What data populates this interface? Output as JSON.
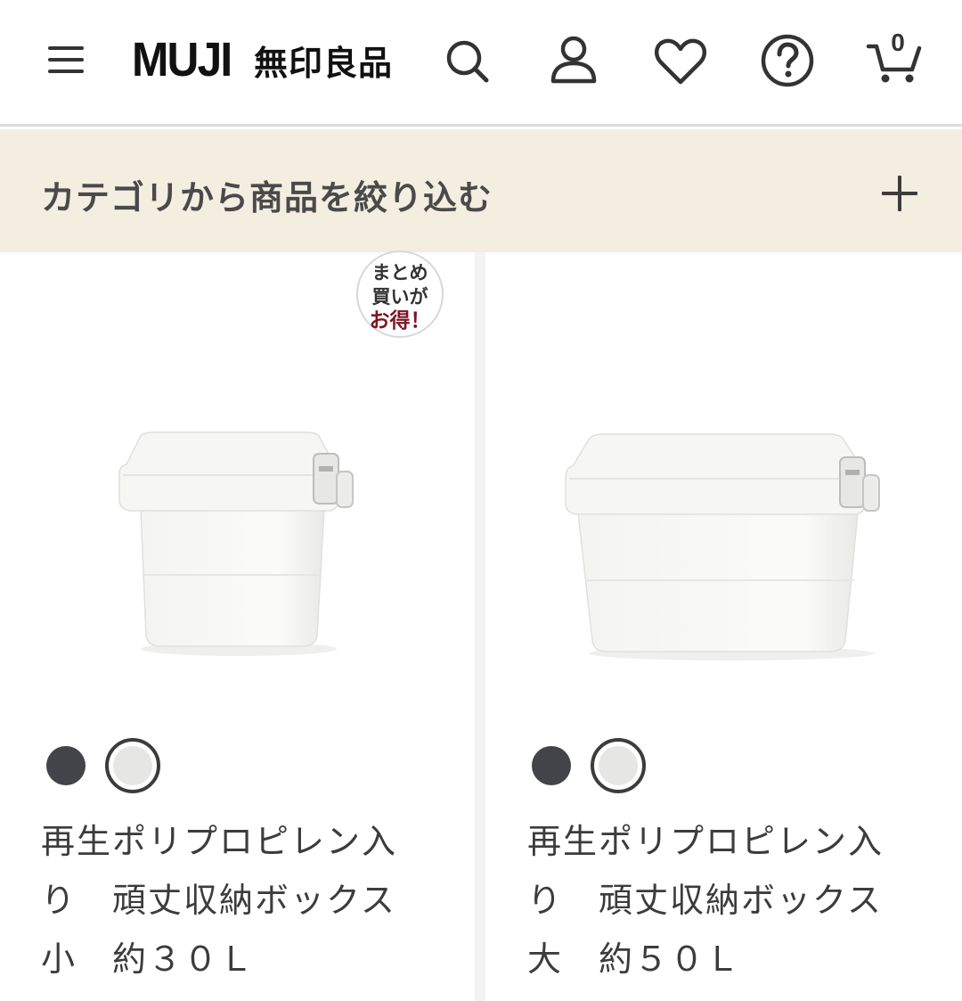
{
  "header": {
    "logo_latin": "MUJI",
    "logo_jp": "無印良品",
    "cart_count": "0",
    "icons": [
      "menu-icon",
      "search-icon",
      "account-icon",
      "heart-icon",
      "help-icon",
      "cart-icon"
    ]
  },
  "filter": {
    "label": "カテゴリから商品を絞り込む",
    "icon": "plus-icon",
    "background": "#f3eee0"
  },
  "products": [
    {
      "badge": {
        "line1": "まとめ",
        "line2": "買いが",
        "line3": "お得！",
        "accent_color": "#7b1623"
      },
      "swatches": [
        "#43444a",
        "#e6e6e4"
      ],
      "selected_swatch": "#e6e6e4",
      "name_lines": [
        "再生ポリプロピレン入",
        "り　頑丈収納ボックス",
        "小　約３０Ｌ"
      ]
    },
    {
      "swatches": [
        "#43444a",
        "#e6e6e4"
      ],
      "selected_swatch": "#e6e6e4",
      "name_lines": [
        "再生ポリプロピレン入",
        "り　頑丈収納ボックス",
        "大　約５０Ｌ"
      ]
    }
  ]
}
